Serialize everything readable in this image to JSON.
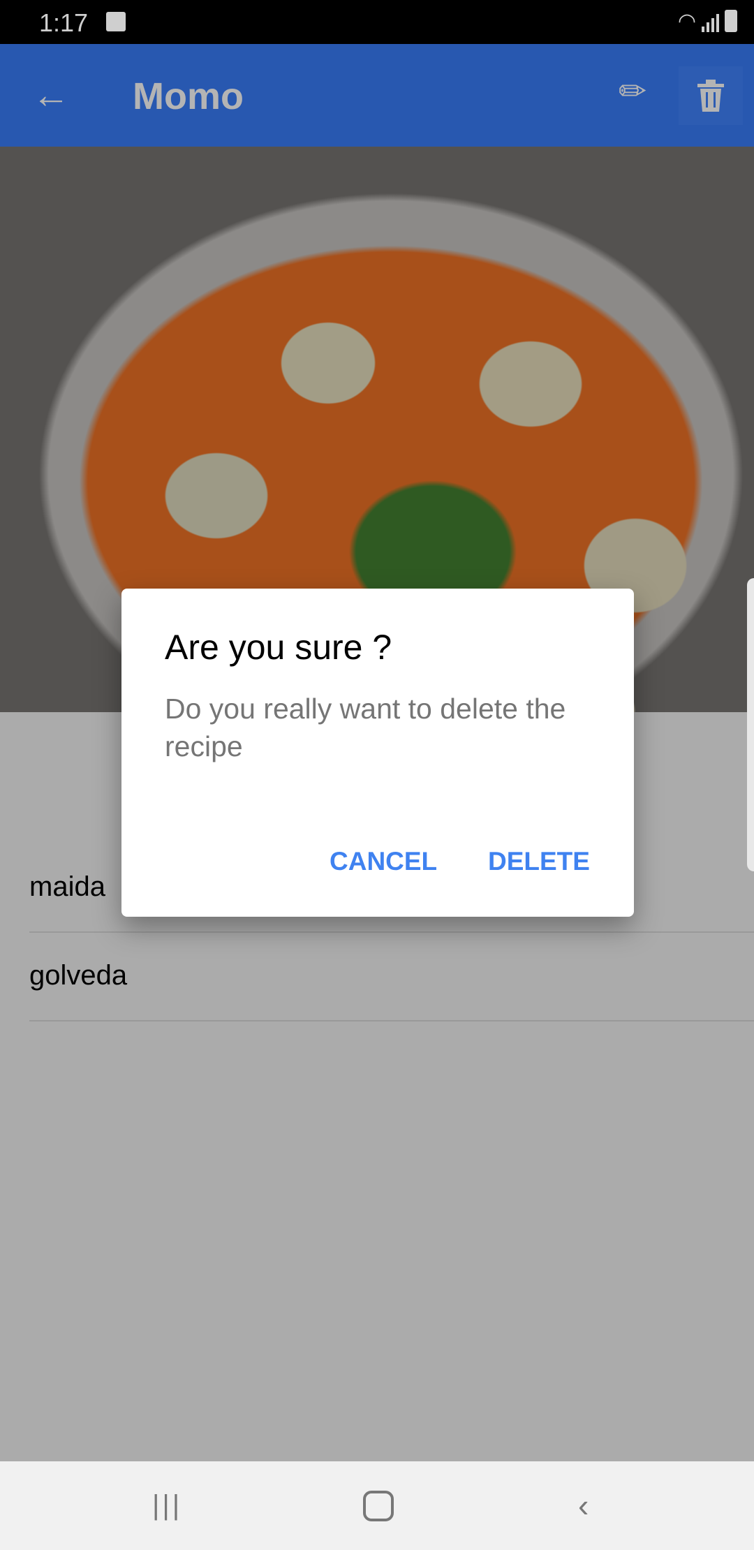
{
  "status_bar": {
    "time": "1:17"
  },
  "app_bar": {
    "title": "Momo",
    "back_icon": "arrow-left-icon",
    "edit_icon": "pencil-icon",
    "delete_icon": "trash-icon",
    "color": "#2858b0"
  },
  "ingredients": [
    "maida",
    "golveda"
  ],
  "dialog": {
    "title": "Are you sure ?",
    "message": "Do you really want to delete the recipe",
    "cancel_label": "CANCEL",
    "delete_label": "DELETE",
    "accent": "#3f82f0"
  }
}
